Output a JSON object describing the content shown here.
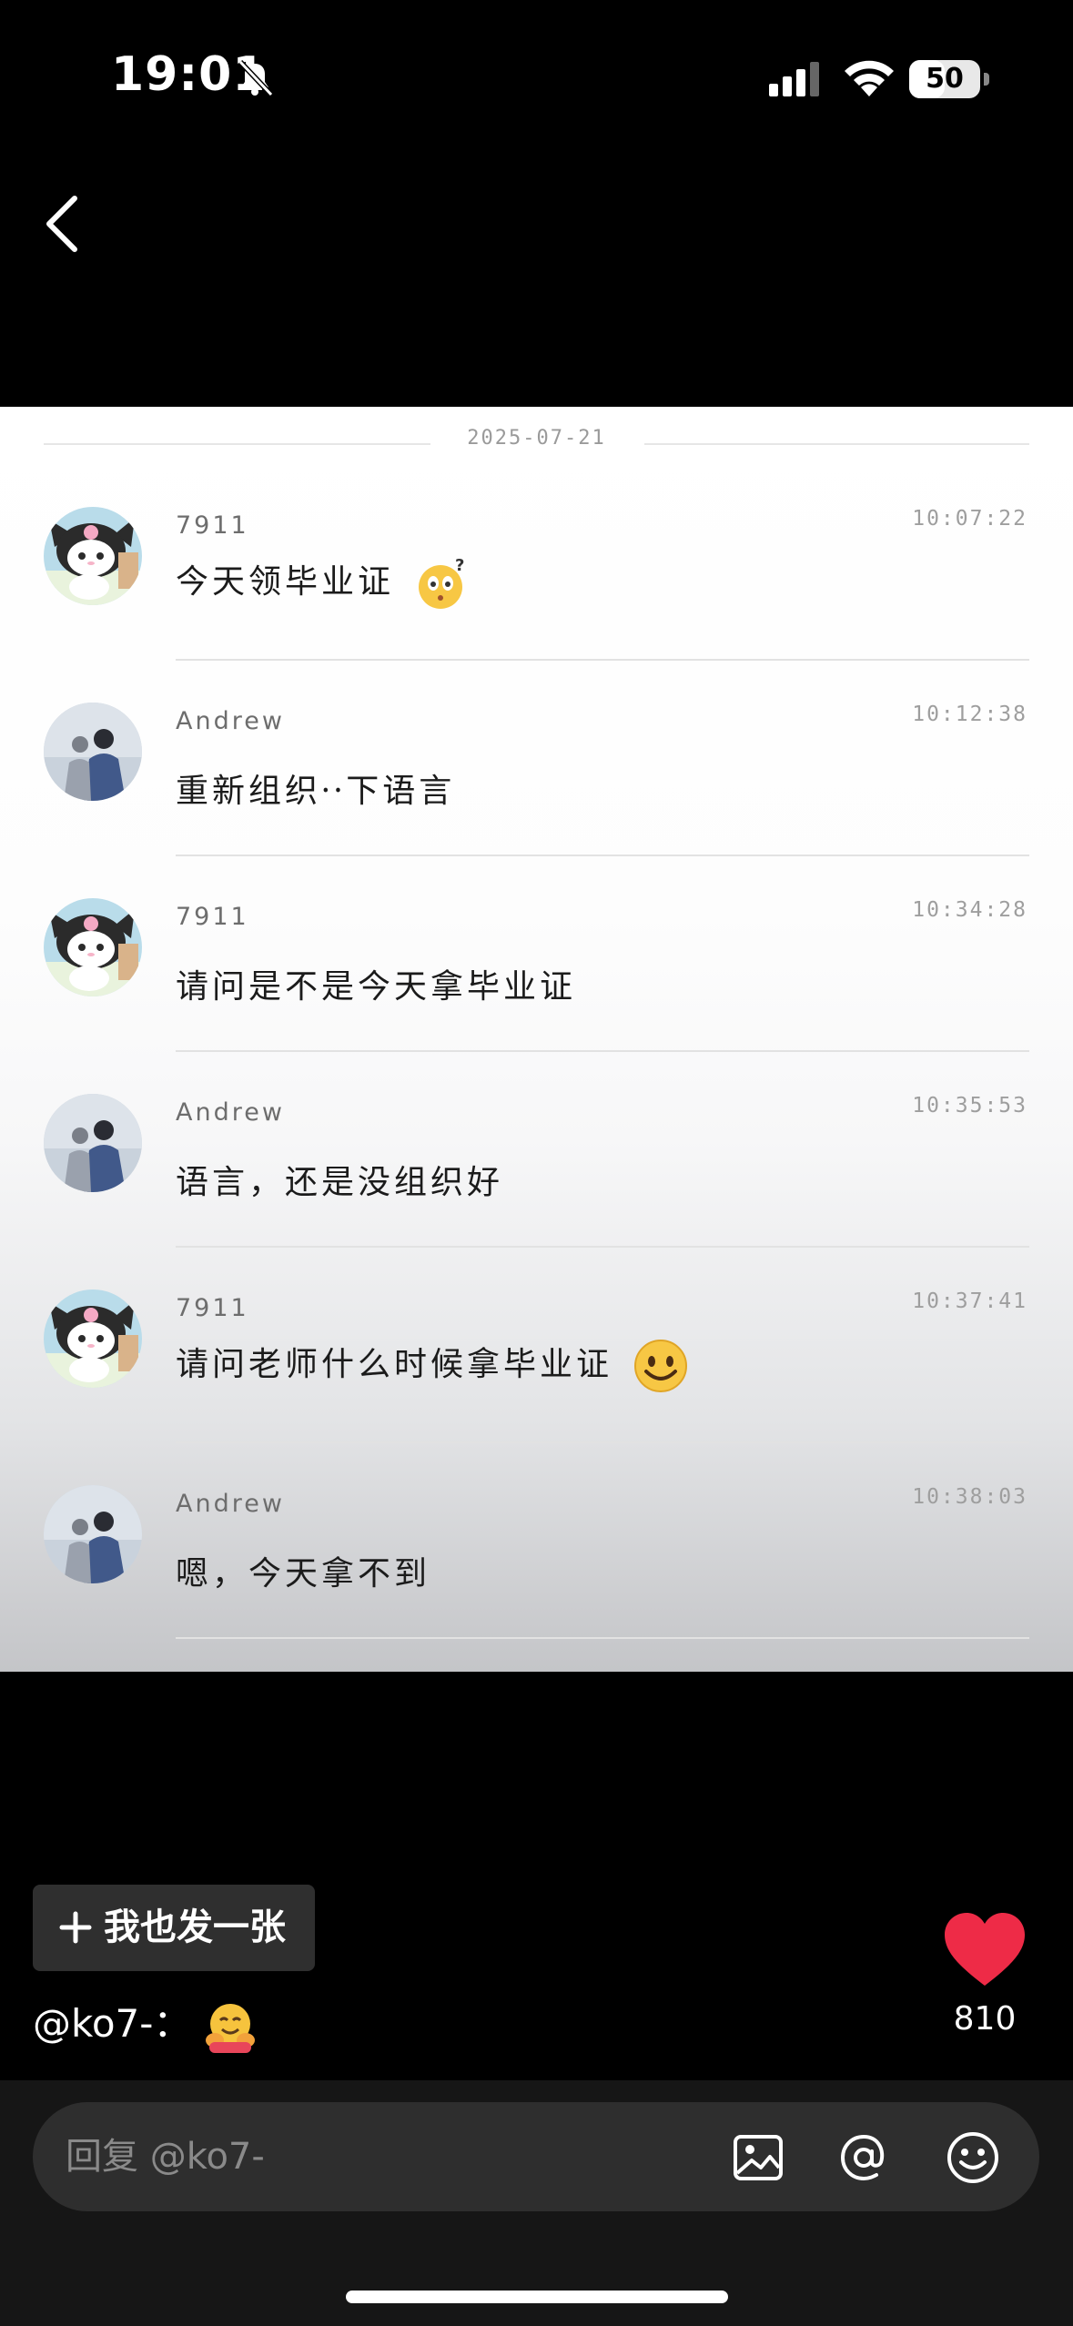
{
  "status_bar": {
    "time": "19:01",
    "battery": "50",
    "battery_level": 0.5
  },
  "chat": {
    "date": "2025-07-21",
    "messages": [
      {
        "name": "7911",
        "time": "10:07:22",
        "text": "今天领毕业证",
        "avatar": "kuromi",
        "emoji": "thinking-face"
      },
      {
        "name": "Andrew",
        "time": "10:12:38",
        "text": "重新组织⸱⸱下语言",
        "avatar": "couple-photo",
        "emoji": ""
      },
      {
        "name": "7911",
        "time": "10:34:28",
        "text": "请问是不是今天拿毕业证",
        "avatar": "kuromi",
        "emoji": ""
      },
      {
        "name": "Andrew",
        "time": "10:35:53",
        "text": "语言，还是没组织好",
        "avatar": "couple-photo",
        "emoji": ""
      },
      {
        "name": "7911",
        "time": "10:37:41",
        "text": "请问老师什么时候拿毕业证",
        "avatar": "kuromi",
        "emoji": "smile-face"
      },
      {
        "name": "Andrew",
        "time": "10:38:03",
        "text": "嗯，今天拿不到",
        "avatar": "couple-photo",
        "emoji": ""
      }
    ]
  },
  "post_button": {
    "label": "我也发一张"
  },
  "author": {
    "handle": "@ko7-：",
    "emoji": "hugging-face"
  },
  "likes": {
    "count": "810",
    "color": "#ee2b47"
  },
  "reply": {
    "placeholder": "回复 @ko7-"
  }
}
